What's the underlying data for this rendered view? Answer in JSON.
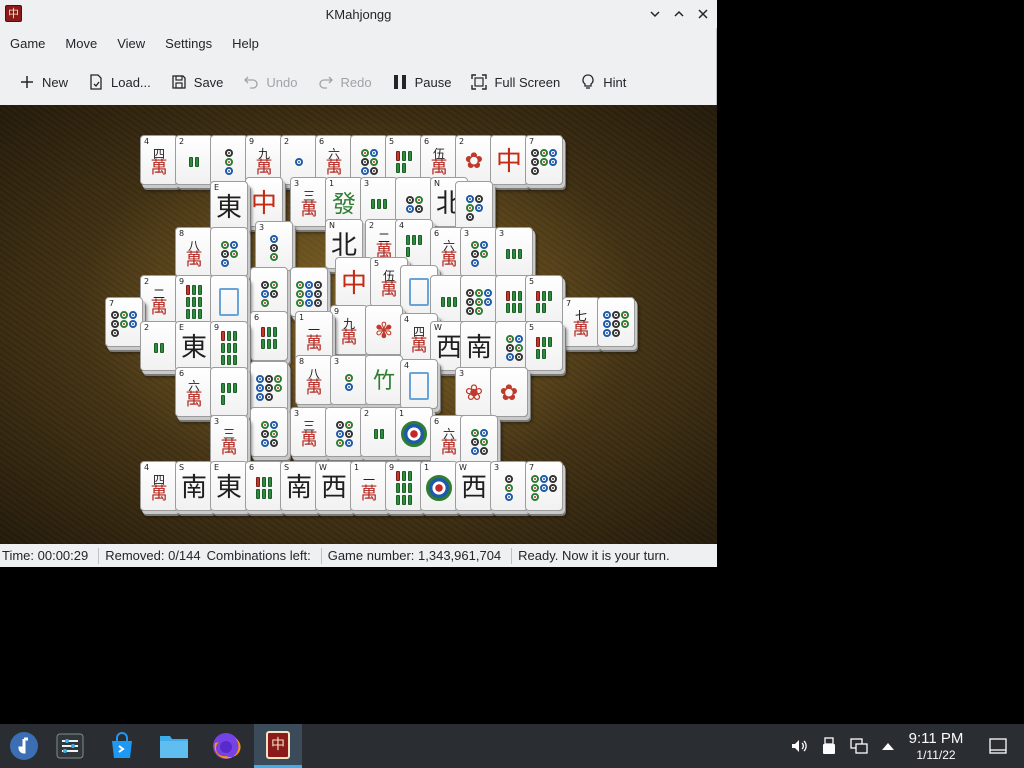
{
  "window": {
    "title": "KMahjongg",
    "app_icon_glyph": "中",
    "minimize_icon": "chevron-down",
    "maximize_icon": "chevron-up",
    "close_icon": "close"
  },
  "menu": {
    "items": [
      {
        "label": "Game"
      },
      {
        "label": "Move"
      },
      {
        "label": "View"
      },
      {
        "label": "Settings"
      },
      {
        "label": "Help"
      }
    ]
  },
  "toolbar": {
    "new": "New",
    "load": "Load...",
    "save": "Save",
    "undo": "Undo",
    "redo": "Redo",
    "pause": "Pause",
    "fullscreen": "Full Screen",
    "hint": "Hint"
  },
  "status": {
    "time": "Time: 00:00:29",
    "removed": "Removed: 0/144",
    "combinations": "Combinations left:",
    "game_number": "Game number: 1,343,961,704",
    "message": "Ready. Now it is your turn."
  },
  "tiles": [
    {
      "idx": "4",
      "t": "char",
      "n": "四"
    },
    {
      "idx": "2",
      "t": "bam",
      "v": 2
    },
    {
      "idx": "",
      "t": "dots",
      "v": 3
    },
    {
      "idx": "9",
      "t": "char",
      "n": "九"
    },
    {
      "idx": "2",
      "t": "dots",
      "v": 1
    },
    {
      "idx": "6",
      "t": "char",
      "n": "六"
    },
    {
      "idx": "",
      "t": "dots",
      "v": 6
    },
    {
      "idx": "5",
      "t": "bam",
      "v": 5
    },
    {
      "idx": "6",
      "t": "char",
      "n": "伍"
    },
    {
      "idx": "2",
      "t": "flower",
      "g": "✿"
    },
    {
      "idx": "",
      "t": "red",
      "g": "中"
    },
    {
      "idx": "7",
      "t": "dots",
      "v": 7
    },
    {
      "idx": "E",
      "t": "wind",
      "g": "東"
    },
    {
      "idx": "",
      "t": "red",
      "g": "中"
    },
    {
      "idx": "3",
      "t": "char",
      "n": "三"
    },
    {
      "idx": "1",
      "t": "green",
      "g": "發"
    },
    {
      "idx": "3",
      "t": "bam",
      "v": 3
    },
    {
      "idx": "",
      "t": "dots",
      "v": 4
    },
    {
      "idx": "N",
      "t": "wind",
      "g": "北"
    },
    {
      "idx": "",
      "t": "dots",
      "v": 5
    },
    {
      "idx": "8",
      "t": "char",
      "n": "八"
    },
    {
      "idx": "",
      "t": "dots",
      "v": 5
    },
    {
      "idx": "3",
      "t": "dots",
      "v": 3
    },
    {
      "idx": "N",
      "t": "wind",
      "g": "北"
    },
    {
      "idx": "2",
      "t": "char",
      "n": "二"
    },
    {
      "idx": "4",
      "t": "bam",
      "v": 4
    },
    {
      "idx": "6",
      "t": "char",
      "n": "六"
    },
    {
      "idx": "3",
      "t": "dots",
      "v": 5
    },
    {
      "idx": "3",
      "t": "bam",
      "v": 3
    },
    {
      "idx": "2",
      "t": "char",
      "n": "二"
    },
    {
      "idx": "9",
      "t": "bam",
      "v": 9
    },
    {
      "idx": "",
      "t": "blank"
    },
    {
      "idx": "",
      "t": "dots",
      "v": 5
    },
    {
      "idx": "",
      "t": "dots",
      "v": 9
    },
    {
      "idx": "",
      "t": "red",
      "g": "中"
    },
    {
      "idx": "5",
      "t": "char",
      "n": "伍"
    },
    {
      "idx": "",
      "t": "blank"
    },
    {
      "idx": "",
      "t": "bam",
      "v": 3
    },
    {
      "idx": "",
      "t": "dots",
      "v": 8
    },
    {
      "idx": "",
      "t": "bam",
      "v": 6
    },
    {
      "idx": "5",
      "t": "bam",
      "v": 5
    },
    {
      "idx": "7",
      "t": "dots",
      "v": 7
    },
    {
      "idx": "7",
      "t": "char",
      "n": "七"
    },
    {
      "idx": "",
      "t": "dots",
      "v": 8
    },
    {
      "idx": "2",
      "t": "bam",
      "v": 2
    },
    {
      "idx": "E",
      "t": "wind",
      "g": "東"
    },
    {
      "idx": "9",
      "t": "bam",
      "v": 9
    },
    {
      "idx": "6",
      "t": "bam",
      "v": 6
    },
    {
      "idx": "1",
      "t": "char",
      "n": "一"
    },
    {
      "idx": "9",
      "t": "char",
      "n": "九"
    },
    {
      "idx": "",
      "t": "flower",
      "g": "✾"
    },
    {
      "idx": "4",
      "t": "char",
      "n": "四"
    },
    {
      "idx": "W",
      "t": "wind",
      "g": "西"
    },
    {
      "idx": "",
      "t": "wind",
      "g": "南"
    },
    {
      "idx": "",
      "t": "dots",
      "v": 6
    },
    {
      "idx": "5",
      "t": "bam",
      "v": 5
    },
    {
      "idx": "6",
      "t": "char",
      "n": "六"
    },
    {
      "idx": "",
      "t": "bam",
      "v": 4
    },
    {
      "idx": "",
      "t": "dots",
      "v": 8
    },
    {
      "idx": "8",
      "t": "char",
      "n": "八"
    },
    {
      "idx": "3",
      "t": "dots",
      "v": 2
    },
    {
      "idx": "",
      "t": "season",
      "g": "竹"
    },
    {
      "idx": "4",
      "t": "blank"
    },
    {
      "idx": "3",
      "t": "flower",
      "g": "❀"
    },
    {
      "idx": "",
      "t": "flower",
      "g": "✿"
    },
    {
      "idx": "3",
      "t": "char",
      "n": "三"
    },
    {
      "idx": "",
      "t": "dots",
      "v": 6
    },
    {
      "idx": "3",
      "t": "char",
      "n": "三"
    },
    {
      "idx": "",
      "t": "dots",
      "v": 6
    },
    {
      "idx": "2",
      "t": "bam",
      "v": 2
    },
    {
      "idx": "1",
      "t": "big"
    },
    {
      "idx": "6",
      "t": "char",
      "n": "六"
    },
    {
      "idx": "",
      "t": "dots",
      "v": 6
    },
    {
      "idx": "4",
      "t": "char",
      "n": "四"
    },
    {
      "idx": "S",
      "t": "wind",
      "g": "南"
    },
    {
      "idx": "E",
      "t": "wind",
      "g": "東"
    },
    {
      "idx": "6",
      "t": "bam",
      "v": 6
    },
    {
      "idx": "S",
      "t": "wind",
      "g": "南"
    },
    {
      "idx": "W",
      "t": "wind",
      "g": "西"
    },
    {
      "idx": "1",
      "t": "char",
      "n": "一"
    },
    {
      "idx": "9",
      "t": "bam",
      "v": 9
    },
    {
      "idx": "1",
      "t": "big"
    },
    {
      "idx": "W",
      "t": "wind",
      "g": "西"
    },
    {
      "idx": "3",
      "t": "dots",
      "v": 3
    },
    {
      "idx": "7",
      "t": "dots",
      "v": 7
    }
  ],
  "taskbar": {
    "clock_time": "9:11 PM",
    "clock_date": "1/11/22",
    "items": [
      "fedora-icon",
      "settings-icon",
      "store-icon",
      "files-icon",
      "firefox-icon",
      "kmahjongg-icon"
    ],
    "tray": [
      "volume-icon",
      "usb-icon",
      "network-icon",
      "arrow-up-icon",
      "desktop-icon"
    ]
  }
}
